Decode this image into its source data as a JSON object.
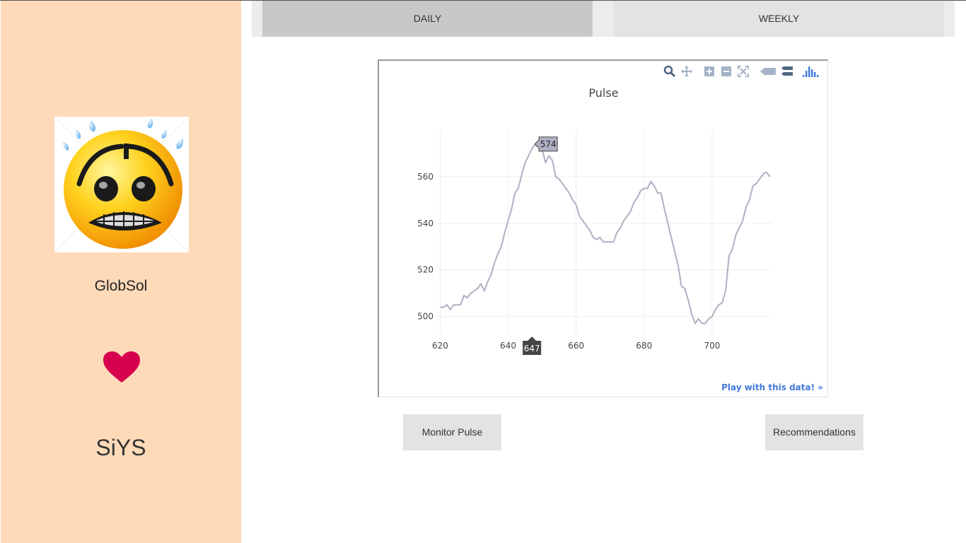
{
  "sidebar": {
    "user_name": "GlobSol",
    "app_name": "SiYS",
    "avatar_icon": "nervous-emoji-icon",
    "heart_icon": "heart-icon",
    "heart_color": "#d6004f",
    "background_color": "#ffdab9"
  },
  "tabs": [
    {
      "label": "DAILY",
      "active": true
    },
    {
      "label": "WEEKLY",
      "active": false
    }
  ],
  "modebar": {
    "icons": [
      "zoom-icon",
      "pan-icon",
      "zoom-in-icon",
      "zoom-out-icon",
      "autoscale-icon",
      "hover-closest-icon",
      "hover-compare-icon",
      "plotly-logo-icon"
    ]
  },
  "chart_data": {
    "type": "line",
    "title": "Pulse",
    "xlabel": "",
    "ylabel": "",
    "xlim": [
      619.5,
      717.5
    ],
    "ylim": [
      492,
      580
    ],
    "xticks": [
      620,
      640,
      660,
      680,
      700
    ],
    "yticks": [
      500,
      520,
      540,
      560
    ],
    "grid": true,
    "line_color": "#b0b0c4",
    "x": [
      620,
      621,
      622,
      623,
      624,
      625,
      626,
      627,
      628,
      629,
      630,
      631,
      632,
      633,
      634,
      635,
      636,
      637,
      638,
      639,
      640,
      641,
      642,
      643,
      644,
      645,
      646,
      647,
      648,
      649,
      650,
      651,
      652,
      653,
      654,
      655,
      656,
      657,
      658,
      659,
      660,
      661,
      662,
      663,
      664,
      665,
      666,
      667,
      668,
      669,
      670,
      671,
      672,
      673,
      674,
      675,
      676,
      677,
      678,
      679,
      680,
      681,
      682,
      683,
      684,
      685,
      686,
      687,
      688,
      689,
      690,
      691,
      692,
      693,
      694,
      695,
      696,
      697,
      698,
      699,
      700,
      701,
      702,
      703,
      704,
      705,
      706,
      707,
      708,
      709,
      710,
      711,
      712,
      713,
      714,
      715,
      716,
      717
    ],
    "y": [
      504,
      504,
      505,
      503,
      505,
      505,
      505,
      509,
      508,
      510,
      511,
      512,
      514,
      511,
      515,
      518,
      523,
      527,
      530,
      536,
      541,
      546,
      553,
      555,
      561,
      566,
      569,
      572,
      574,
      574,
      572,
      566,
      569,
      567,
      560,
      559,
      557,
      555,
      553,
      550,
      548,
      543,
      541,
      539,
      537,
      534,
      533,
      534,
      532,
      532,
      532,
      532,
      536,
      538,
      541,
      543,
      545,
      549,
      551,
      554,
      555,
      555,
      558,
      556,
      553,
      553,
      546,
      540,
      534,
      528,
      522,
      513,
      512,
      507,
      501,
      497,
      499,
      497,
      497,
      499,
      500,
      503,
      505,
      506,
      511,
      526,
      529,
      535,
      538,
      541,
      547,
      550,
      556,
      557,
      559,
      561,
      562,
      560
    ],
    "hover_point": {
      "x": 647,
      "y": 574
    },
    "hover_x_label": "647",
    "hover_y_label": "574"
  },
  "chart": {
    "play_link": "Play with this data! »"
  },
  "buttons": {
    "monitor": "Monitor Pulse",
    "recommendations": "Recommendations"
  }
}
